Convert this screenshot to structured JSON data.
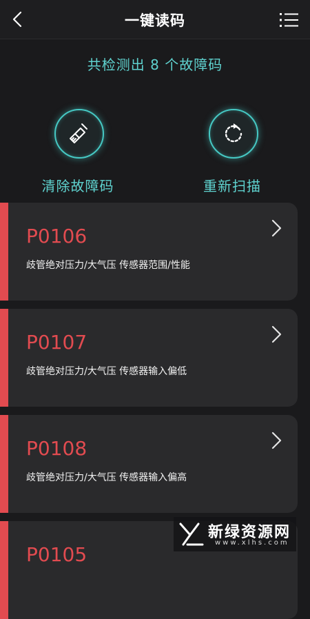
{
  "header": {
    "title": "一键读码"
  },
  "summary": {
    "text": "共检测出 8 个故障码"
  },
  "actions": {
    "clear_label": "清除故障码",
    "rescan_label": "重新扫描"
  },
  "faults": [
    {
      "code": "P0106",
      "description": "歧管绝对压力/大气压 传感器范围/性能"
    },
    {
      "code": "P0107",
      "description": "歧管绝对压力/大气压 传感器输入偏低"
    },
    {
      "code": "P0108",
      "description": "歧管绝对压力/大气压 传感器输入偏高"
    },
    {
      "code": "P0105",
      "description": ""
    }
  ],
  "watermark": {
    "title": "新绿资源网",
    "url": "www.xlhs.com"
  },
  "colors": {
    "accent": "#46c9c4",
    "fault": "#e24b50",
    "background": "#1a1a1c",
    "card": "#2a2a2c"
  },
  "icons": {
    "back": "chevron-left-icon",
    "menu": "list-menu-icon",
    "clear": "broom-icon",
    "rescan": "refresh-icon",
    "row": "chevron-right-icon"
  }
}
